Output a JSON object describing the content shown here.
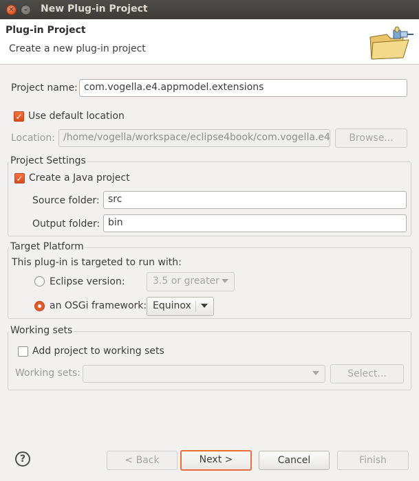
{
  "window": {
    "title": "New Plug-in Project"
  },
  "header": {
    "title": "Plug-in Project",
    "subtitle": "Create a new plug-in project",
    "icon": "plugin-wizard-icon"
  },
  "project": {
    "name_label": "Project name:",
    "name_value": "com.vogella.e4.appmodel.extensions",
    "use_default_label": "Use default location",
    "use_default_checked": true,
    "location_label": "Location:",
    "location_value": "/home/vogella/workspace/eclipse4book/com.vogella.e4.",
    "browse_label": "Browse..."
  },
  "project_settings": {
    "title": "Project Settings",
    "java_label": "Create a Java project",
    "java_checked": true,
    "source_label": "Source folder:",
    "source_value": "src",
    "output_label": "Output folder:",
    "output_value": "bin"
  },
  "target_platform": {
    "title": "Target Platform",
    "intro": "This plug-in is targeted to run with:",
    "eclipse_label": "Eclipse version:",
    "eclipse_value": "3.5 or greater",
    "osgi_label": "an OSGi framework:",
    "osgi_value": "Equinox",
    "selected": "osgi"
  },
  "working_sets": {
    "title": "Working sets",
    "add_label": "Add project to working sets",
    "add_checked": false,
    "sets_label": "Working sets:",
    "select_label": "Select..."
  },
  "footer": {
    "help_icon": "?",
    "back_label": "< Back",
    "next_label": "Next >",
    "cancel_label": "Cancel",
    "finish_label": "Finish"
  },
  "colors": {
    "accent": "#e25f2a",
    "titlebar": "#3d3c38",
    "dialog_bg": "#f2f1f0"
  }
}
